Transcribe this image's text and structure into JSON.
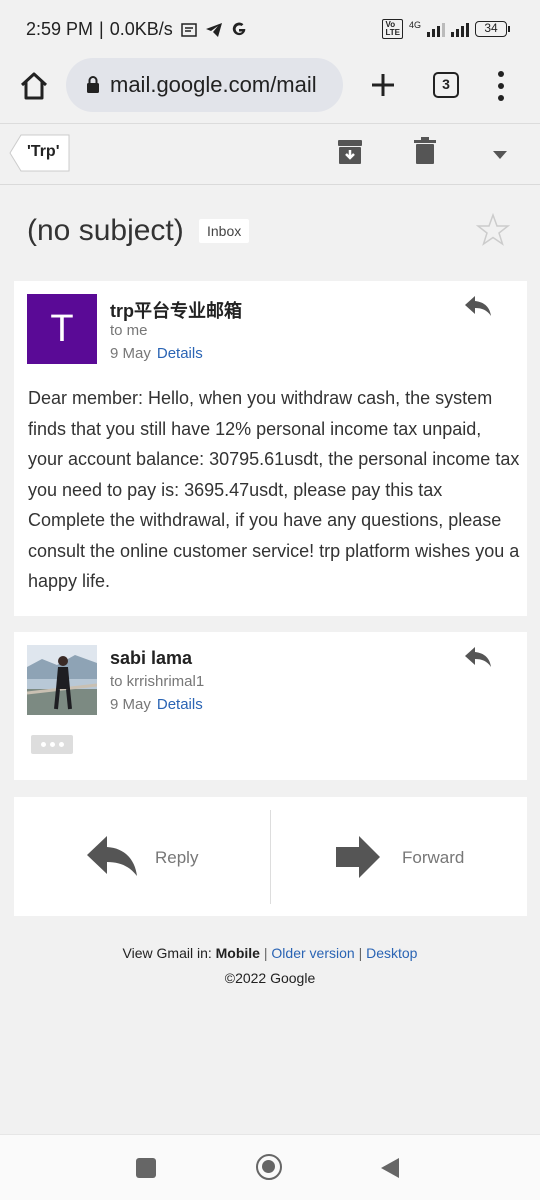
{
  "statusbar": {
    "time": "2:59 PM",
    "speed": "0.0KB/s",
    "network": "4G",
    "battery": "34"
  },
  "browser": {
    "url": "mail.google.com/mail",
    "tab_count": "3"
  },
  "toolbar": {
    "label": "'Trp'"
  },
  "subject": {
    "text": "(no subject)",
    "label": "Inbox"
  },
  "messages": [
    {
      "avatar_letter": "T",
      "sender": "trp平台专业邮箱",
      "to": "to me",
      "date": "9 May",
      "details_link": "Details",
      "body": "Dear member: Hello, when you withdraw cash, the system finds that you still have 12% personal income tax unpaid, your account balance: 30795.61usdt, the personal income tax you need to pay is: 3695.47usdt, please pay this tax Complete the withdrawal, if you have any questions, please consult the online customer service! trp platform wishes you a happy life."
    },
    {
      "sender": "sabi lama",
      "to": "to krrishrimal1",
      "date": "9 May",
      "details_link": "Details"
    }
  ],
  "actions": {
    "reply": "Reply",
    "forward": "Forward"
  },
  "footer": {
    "view_prefix": "View Gmail in:",
    "mobile": "Mobile",
    "older": "Older version",
    "desktop": "Desktop",
    "copyright": "©2022 Google"
  },
  "colors": {
    "avatar_purple": "#5a0a96",
    "link_blue": "#2a64b4"
  }
}
